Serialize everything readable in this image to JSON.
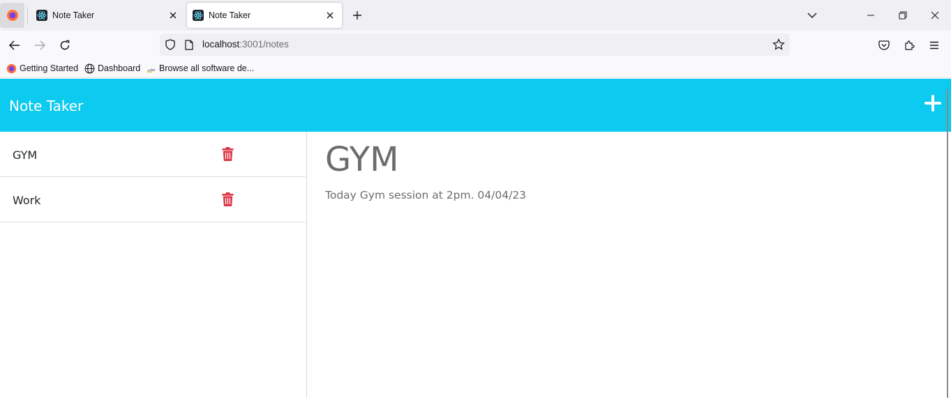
{
  "browser": {
    "tabs": [
      {
        "title": "Note Taker",
        "active": false
      },
      {
        "title": "Note Taker",
        "active": true
      }
    ],
    "url": {
      "host": "localhost",
      "path": ":3001/notes"
    },
    "bookmarks": [
      {
        "label": "Getting Started",
        "icon": "firefox-icon"
      },
      {
        "label": "Dashboard",
        "icon": "globe-icon"
      },
      {
        "label": "Browse all software de...",
        "icon": "page-icon"
      }
    ]
  },
  "app": {
    "title": "Note Taker",
    "header_color": "#0dcaf0",
    "notes": [
      {
        "title": "GYM"
      },
      {
        "title": "Work"
      }
    ],
    "current_note": {
      "title": "GYM",
      "text": "Today Gym session at 2pm. 04/04/23"
    },
    "delete_color": "#dc3545"
  }
}
